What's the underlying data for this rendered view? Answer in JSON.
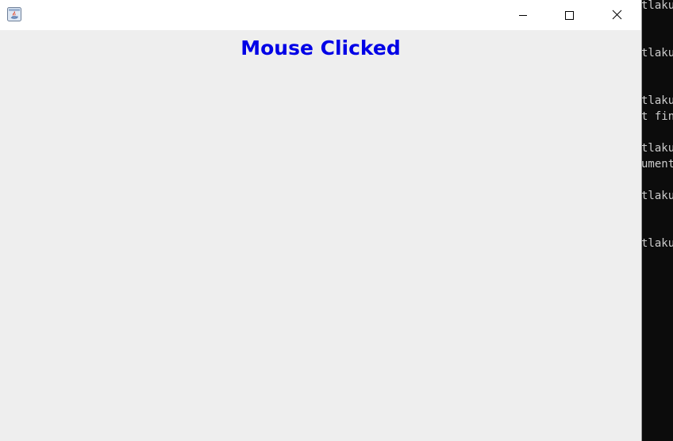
{
  "window": {
    "title": ""
  },
  "content": {
    "status_text": "Mouse Clicked",
    "status_color": "#0000e6"
  },
  "terminal": {
    "lines": [
      "tlaku",
      "tlaku",
      "tlaku",
      "t fin",
      "tlaku",
      "ument",
      "tlaku",
      "tlaku"
    ]
  },
  "icons": {
    "app": "java-icon",
    "minimize": "minimize-icon",
    "maximize": "maximize-icon",
    "close": "close-icon"
  }
}
